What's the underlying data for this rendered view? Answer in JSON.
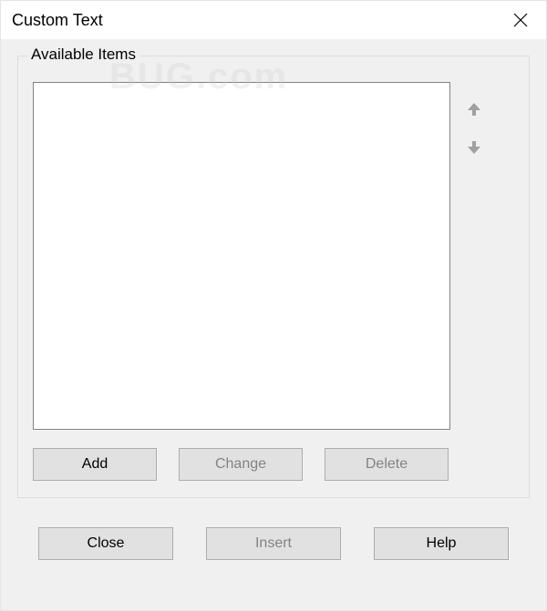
{
  "titlebar": {
    "title": "Custom Text"
  },
  "group": {
    "label": "Available Items"
  },
  "list": {
    "items": []
  },
  "buttons": {
    "add": "Add",
    "change": "Change",
    "delete": "Delete",
    "close": "Close",
    "insert": "Insert",
    "help": "Help"
  },
  "icons": {
    "close": "close",
    "up": "arrow-up",
    "down": "arrow-down"
  },
  "state": {
    "change_enabled": false,
    "delete_enabled": false,
    "insert_enabled": false
  },
  "watermark": "BUG.com"
}
